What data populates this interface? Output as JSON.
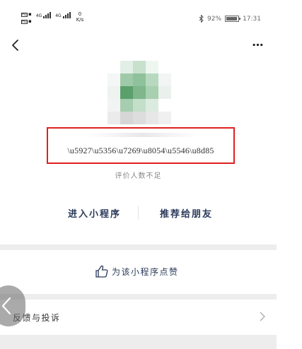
{
  "status_bar": {
    "sim1_label": "HD",
    "sim2_label": "HD",
    "net_4g_1": "4G",
    "net_4g_2": "4G",
    "speed_value": "0",
    "speed_unit": "K/s",
    "battery_percent": "92%",
    "time": "17:31"
  },
  "nav": {
    "back_icon": "chevron-left-icon",
    "more_label": "⋯"
  },
  "app": {
    "name": "\\u5927\\u5356\\u7269\\u8054\\u5546\\u8d85",
    "rating_text": "评价人数不足"
  },
  "actions": {
    "enter_label": "进入小程序",
    "recommend_label": "推荐给朋友"
  },
  "like": {
    "label": "为该小程序点赞",
    "icon": "thumbs-up-icon"
  },
  "feedback": {
    "label": "反馈与投诉",
    "icon": "chevron-right-icon"
  },
  "colors": {
    "highlight_border": "#e02020",
    "action_text": "#2a3a5a",
    "logo_green_dark": "#4e9a64",
    "logo_green_light": "#a9d2b3"
  }
}
